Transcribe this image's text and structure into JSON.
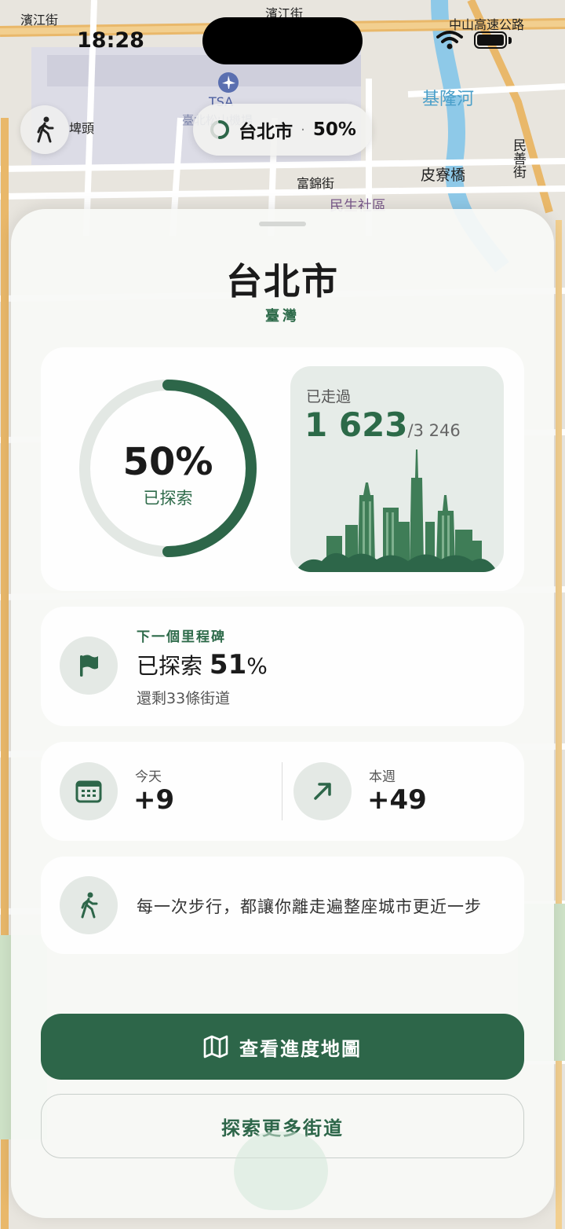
{
  "map": {
    "labels": [
      "濱江街",
      "濱江街",
      "中山高速公路",
      "TSA",
      "臺北松山機場",
      "基隆河",
      "埤頭",
      "民善街",
      "皮寮橋",
      "富錦街",
      "民生社區"
    ]
  },
  "status": {
    "time": "18:28"
  },
  "pill": {
    "city": "台北市",
    "separator": "·",
    "percent": "50%"
  },
  "sheet": {
    "title": "台北市",
    "subtitle": "臺灣",
    "progress": {
      "percent_text": "50%",
      "percent_value": 0.5,
      "label": "已探索",
      "walked_label": "已走過",
      "walked_count": "1 623",
      "walked_total": "/3 246"
    },
    "milestone": {
      "kicker": "下一個里程碑",
      "prefix": "已探索 ",
      "value": "51",
      "unit": "%",
      "remaining": "還剩33條街道"
    },
    "stats": {
      "today_label": "今天",
      "today_value": "+9",
      "week_label": "本週",
      "week_value": "+49"
    },
    "tip": "每一次步行，都讓你離走遍整座城市更近一步",
    "primary_button": "查看進度地圖",
    "secondary_button": "探索更多街道"
  },
  "colors": {
    "accent": "#2d6649",
    "ring_track": "#e3e8e4",
    "sheet_bg": "#f8f9f7"
  },
  "icons": [
    "walk-icon",
    "progress-ring-icon",
    "flag-icon",
    "calendar-icon",
    "trend-arrow-icon",
    "walker-icon",
    "map-icon",
    "wifi-icon",
    "battery-icon",
    "airport-icon"
  ]
}
